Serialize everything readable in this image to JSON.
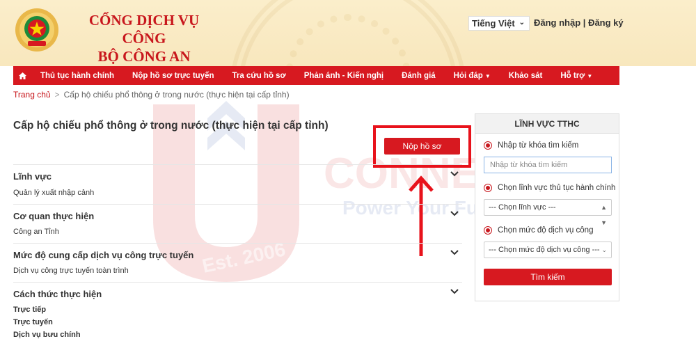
{
  "header": {
    "title_line1": "CỔNG DỊCH VỤ CÔNG",
    "title_line2": "BỘ CÔNG AN",
    "language": "Tiếng Việt",
    "login": "Đăng nhập",
    "auth_sep": "|",
    "register": "Đăng ký"
  },
  "nav": {
    "home_icon": "home-icon",
    "items": [
      {
        "label": "Thủ tục hành chính"
      },
      {
        "label": "Nộp hồ sơ trực tuyến"
      },
      {
        "label": "Tra cứu hồ sơ"
      },
      {
        "label": "Phản ánh - Kiến nghị"
      },
      {
        "label": "Đánh giá"
      },
      {
        "label": "Hỏi đáp"
      },
      {
        "label": "Khảo sát"
      },
      {
        "label": "Hỗ trợ"
      }
    ]
  },
  "breadcrumb": {
    "home": "Trang chủ",
    "sep": ">",
    "current": "Cấp hộ chiếu phổ thông ở trong nước (thực hiện tại cấp tỉnh)"
  },
  "main": {
    "title": "Cấp hộ chiếu phổ thông ở trong nước (thực hiện tại cấp tỉnh)",
    "submit_label": "Nộp hồ sơ",
    "sections": [
      {
        "title": "Lĩnh vực",
        "value": "Quản lý xuất nhập cảnh"
      },
      {
        "title": "Cơ quan thực hiện",
        "value": "Công an Tỉnh"
      },
      {
        "title": "Mức độ cung cấp dịch vụ công trực tuyến",
        "value": "Dịch vụ công trực tuyến toàn trình"
      },
      {
        "title": "Cách thức thực hiện",
        "methods": [
          "Trực tiếp",
          "Trực tuyến",
          "Dịch vụ bưu chính"
        ]
      }
    ]
  },
  "sidebar": {
    "title": "LĨNH VỰC TTHC",
    "keyword_label": "Nhập từ khóa tìm kiếm",
    "keyword_placeholder": "Nhập từ khóa tìm kiếm",
    "field_label": "Chọn lĩnh vực thủ tục hành chính",
    "field_select": "--- Chọn lĩnh vực ---",
    "level_label": "Chọn mức độ dịch vụ công",
    "level_select": "--- Chọn mức độ dịch vụ công ---",
    "search_label": "Tìm kiếm"
  },
  "watermark": {
    "brand": "CONNECT",
    "tagline": "Power Your Future",
    "est": "Est. 2006"
  },
  "colors": {
    "brand_red": "#d71920",
    "header_bg": "#fbeecb",
    "highlight": "#e8121b"
  }
}
